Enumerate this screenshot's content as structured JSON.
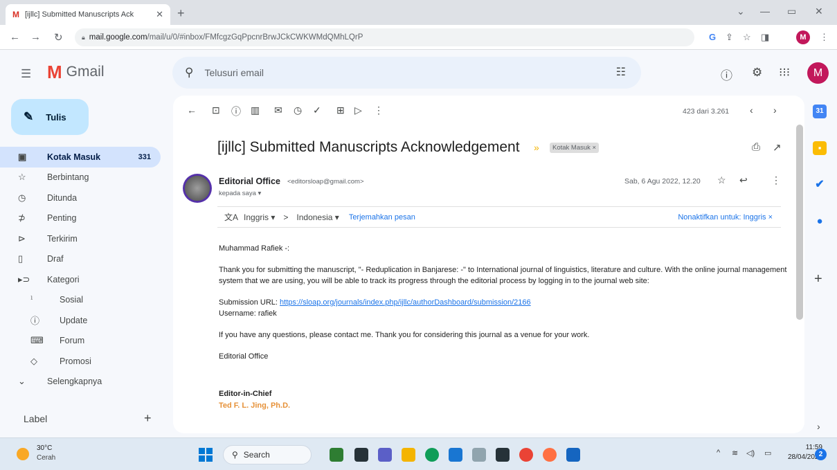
{
  "browser": {
    "tab_title": "[ijllc] Submitted Manuscripts Ack",
    "tab_favicon": "M",
    "url_host": "mail.google.com",
    "url_path": "/mail/u/0/#inbox/FMfcgzGqPpcnrBrwJCkCWKWMdQMhLQrP",
    "profile_initial": "M"
  },
  "gmail": {
    "app_name": "Gmail",
    "search_placeholder": "Telusuri email",
    "avatar_initial": "M",
    "compose_label": "Tulis"
  },
  "sidebar": {
    "items": [
      {
        "icon": "inbox-icon",
        "glyph": "▣",
        "label": "Kotak Masuk",
        "count": "331",
        "active": true
      },
      {
        "icon": "star-icon",
        "glyph": "☆",
        "label": "Berbintang"
      },
      {
        "icon": "clock-icon",
        "glyph": "◷",
        "label": "Ditunda"
      },
      {
        "icon": "important-icon",
        "glyph": "⊅",
        "label": "Penting"
      },
      {
        "icon": "sent-icon",
        "glyph": "⊳",
        "label": "Terkirim"
      },
      {
        "icon": "draft-icon",
        "glyph": "▯",
        "label": "Draf"
      },
      {
        "icon": "category-icon",
        "glyph": "▸⊃",
        "label": "Kategori"
      },
      {
        "icon": "people-icon",
        "glyph": "ᣳ",
        "label": "Sosial",
        "sub": true
      },
      {
        "icon": "info-icon",
        "glyph": "ⓘ",
        "label": "Update",
        "sub": true
      },
      {
        "icon": "forum-icon",
        "glyph": "⌨",
        "label": "Forum",
        "sub": true
      },
      {
        "icon": "tag-icon",
        "glyph": "◇",
        "label": "Promosi",
        "sub": true
      },
      {
        "icon": "expand-icon",
        "glyph": "⌄",
        "label": "Selengkapnya"
      }
    ],
    "label_header": "Label"
  },
  "toolbar": {
    "pager": "423 dari 3.261"
  },
  "email": {
    "subject": "[ijllc] Submitted Manuscripts Acknowledgement",
    "label_chip": "Kotak Masuk ×",
    "sender_name": "Editorial Office",
    "sender_email": "<editorsloap@gmail.com>",
    "recipient": "kepada saya ▾",
    "date": "Sab, 6 Agu 2022, 12.20",
    "translate": {
      "from": "Inggris ▾",
      "arrow": ">",
      "to": "Indonesia ▾",
      "action": "Terjemahkan pesan",
      "disable": "Nonaktifkan untuk: Inggris ×"
    },
    "greeting": "Muhammad Rafiek -:",
    "para1": "Thank you for submitting the manuscript, \"- Reduplication in Banjarese: -\" to International journal of linguistics, literature and culture. With the online journal management system that we are using, you will be able to track its progress through the editorial process by logging in to the journal web site:",
    "url_label": "Submission URL: ",
    "url": "https://sloap.org/journals/index.php/ijllc/authorDashboard/submission/2166",
    "username": "Username: rafiek",
    "para2": "If you have any questions, please contact me. Thank you for considering this journal as a venue for your work.",
    "signoff": "Editorial Office",
    "sig_title": "Editor-in-Chief",
    "sig_name": "Ted F. L. Jing, Ph.D."
  },
  "taskbar": {
    "temp": "30°C",
    "condition": "Cerah",
    "search_label": "Search",
    "time": "11:59",
    "date": "28/04/2023",
    "notif_count": "2"
  },
  "colors": {
    "accent": "#1a73e8",
    "compose_bg": "#c2e7ff",
    "active_item": "#d3e3fd",
    "avatar": "#c2185b"
  }
}
